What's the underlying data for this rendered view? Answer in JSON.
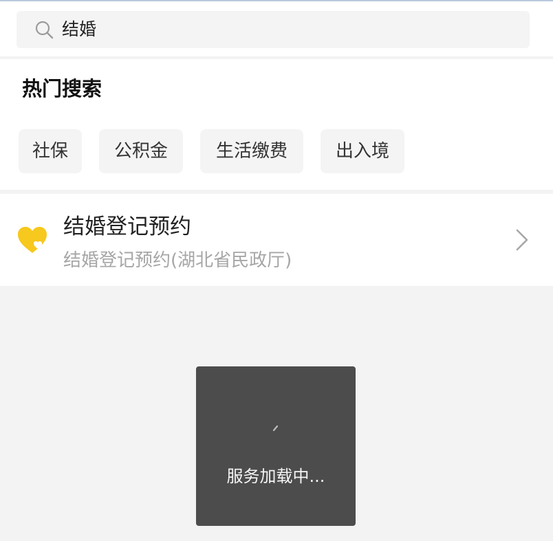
{
  "search": {
    "value": "结婚"
  },
  "hot_search": {
    "title": "热门搜索",
    "chips": [
      {
        "label": "社保"
      },
      {
        "label": "公积金"
      },
      {
        "label": "生活缴费"
      },
      {
        "label": "出入境"
      }
    ]
  },
  "result": {
    "icon": "heart-icon",
    "title": "结婚登记预约",
    "subtitle": "结婚登记预约(湖北省民政厅)"
  },
  "toast": {
    "text": "服务加载中..."
  },
  "colors": {
    "accent_yellow": "#f7c81e",
    "toast_bg": "#4c4c4c",
    "page_bg": "#f3f3f3"
  }
}
